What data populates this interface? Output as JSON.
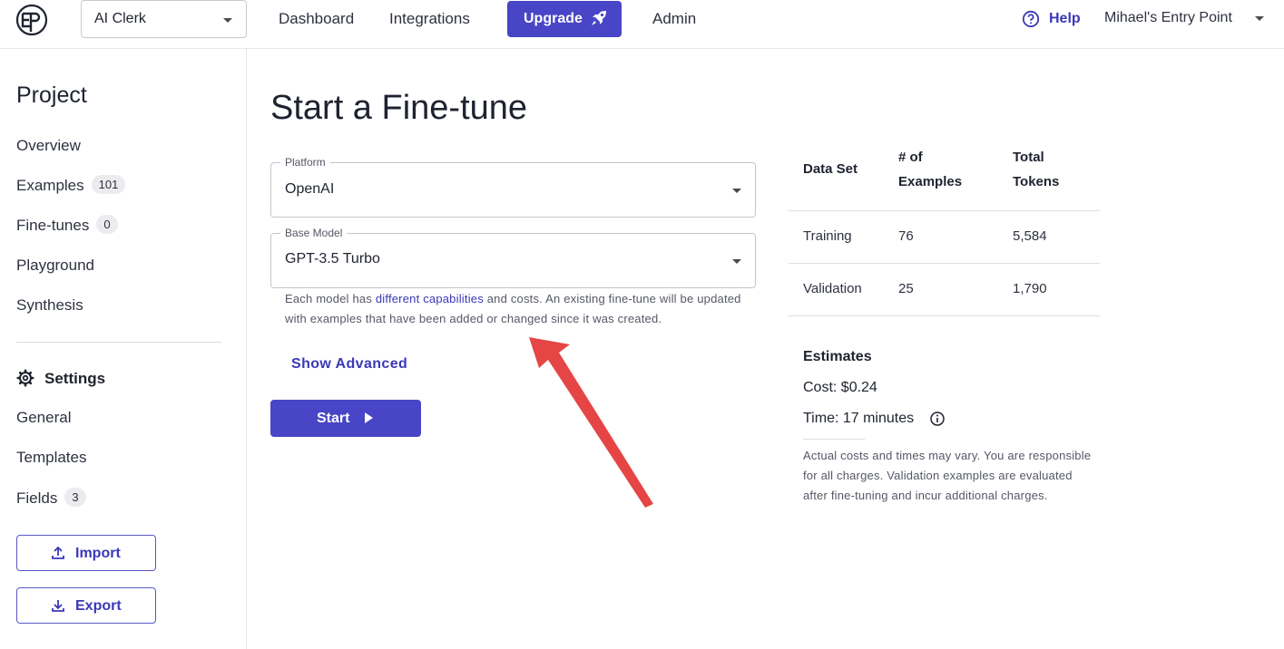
{
  "topbar": {
    "logo_icon": "ep-logo-icon",
    "project_selector": "AI Clerk",
    "nav": [
      "Dashboard",
      "Integrations",
      "Upgrade",
      "Admin"
    ],
    "upgrade_icon": "rocket-icon",
    "help_label": "Help",
    "account_label": "Mihael's Entry Point"
  },
  "sidebar": {
    "title": "Project",
    "items": [
      {
        "label": "Overview",
        "badge": null
      },
      {
        "label": "Examples",
        "badge": "101"
      },
      {
        "label": "Fine-tunes",
        "badge": "0"
      },
      {
        "label": "Playground",
        "badge": null
      },
      {
        "label": "Synthesis",
        "badge": null
      }
    ],
    "settings_title": "Settings",
    "settings_items": [
      {
        "label": "General",
        "badge": null
      },
      {
        "label": "Templates",
        "badge": null
      },
      {
        "label": "Fields",
        "badge": "3"
      }
    ],
    "import_label": "Import",
    "export_label": "Export"
  },
  "main": {
    "title": "Start a Fine-tune",
    "platform": {
      "label": "Platform",
      "value": "OpenAI"
    },
    "base_model": {
      "label": "Base Model",
      "value": "GPT-3.5 Turbo"
    },
    "helper_before_link": "Each model has ",
    "helper_link": "different capabilities",
    "helper_after_link": " and costs. An existing fine-tune will be updated with examples that have been added or changed since it was created.",
    "show_advanced": "Show Advanced",
    "start_label": "Start"
  },
  "stats": {
    "headers": [
      "Data Set",
      "# of Examples",
      "Total Tokens"
    ],
    "header_lines": {
      "examples": [
        "# of",
        "Examples"
      ],
      "tokens": [
        "Total",
        "Tokens"
      ]
    },
    "rows": [
      {
        "set": "Training",
        "examples": "76",
        "tokens": "5,584"
      },
      {
        "set": "Validation",
        "examples": "25",
        "tokens": "1,790"
      }
    ]
  },
  "estimates": {
    "title": "Estimates",
    "cost": "Cost: $0.24",
    "time": "Time: 17 minutes",
    "disclaimer": "Actual costs and times may vary. You are responsible for all charges. Validation examples are evaluated after fine-tuning and incur additional charges."
  },
  "colors": {
    "primary": "#4845c6",
    "link": "#3a38b8",
    "annotation_arrow": "#e64545"
  }
}
